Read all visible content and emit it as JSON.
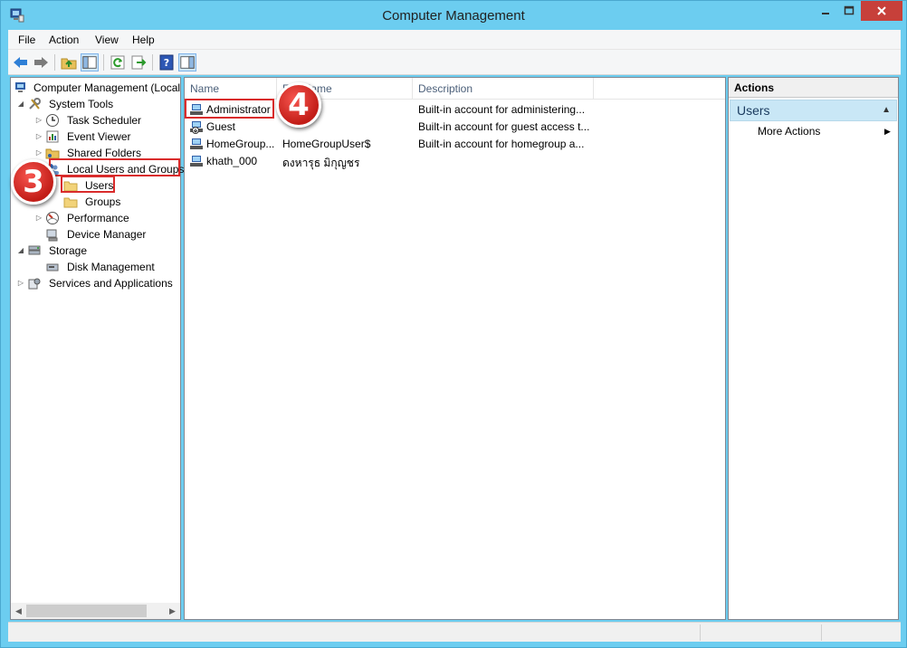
{
  "window": {
    "title": "Computer Management"
  },
  "menu": [
    "File",
    "Action",
    "View",
    "Help"
  ],
  "tree": {
    "root": "Computer Management (Local",
    "system_tools": "System Tools",
    "task_scheduler": "Task Scheduler",
    "event_viewer": "Event Viewer",
    "shared_folders": "Shared Folders",
    "local_users_groups": "Local Users and Groups",
    "users": "Users",
    "groups": "Groups",
    "performance": "Performance",
    "device_manager": "Device Manager",
    "storage": "Storage",
    "disk_management": "Disk Management",
    "services_apps": "Services and Applications"
  },
  "list": {
    "columns": [
      "Name",
      "Full Name",
      "Description"
    ],
    "rows": [
      {
        "name": "Administrator",
        "full_name": "",
        "description": "Built-in account for administering..."
      },
      {
        "name": "Guest",
        "full_name": "",
        "description": "Built-in account for guest access t..."
      },
      {
        "name": "HomeGroup...",
        "full_name": "HomeGroupUser$",
        "description": "Built-in account for homegroup a..."
      },
      {
        "name": "khath_000",
        "full_name": "ดงหารุธ มิกุญชร",
        "description": ""
      }
    ]
  },
  "actions": {
    "header": "Actions",
    "group": "Users",
    "more_actions": "More Actions"
  },
  "callouts": {
    "step3": "3",
    "step4": "4"
  },
  "colors": {
    "accent_titlebar": "#6ccdf0",
    "close_button": "#c7403a",
    "highlight_red": "#d92b2b",
    "selection_blue": "#c9e7f6"
  }
}
